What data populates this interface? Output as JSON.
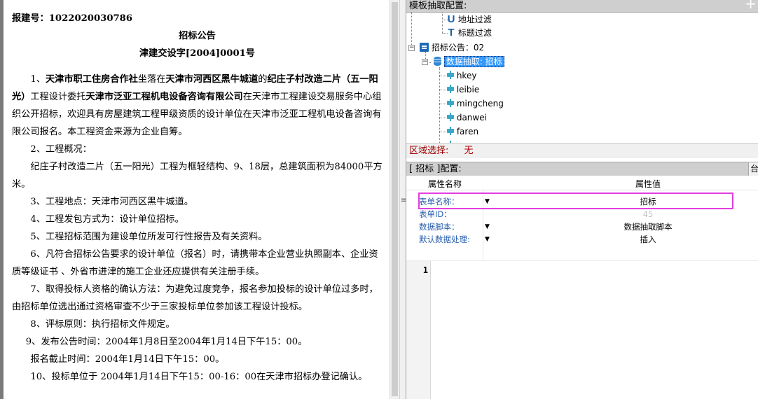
{
  "document": {
    "report_no": "报建号：1022020030786",
    "title": "招标公告",
    "code": "津建交设字[2004]0001号",
    "p1_prefix": "1、",
    "p1_b1": "天津市职工住房合作社",
    "p1_t1": "坐落在",
    "p1_b2": "天津市河西区黑牛城道",
    "p1_t2": "的",
    "p1_b3": "纪庄子村改造二片（五一阳光）",
    "p1_t3": "工程设计委托",
    "p1_b4": "天津市泛亚工程机电设备咨询有限公司",
    "p1_t4": "在天津市工程建设交易服务中心组织公开招标，欢迎具有房屋建筑工程甲级资质的设计单位在天津市泛亚工程机电设备咨询有限公司报名。本工程资金来源为企业自筹。",
    "p2": "2、工程概况：",
    "p2_body": "纪庄子村改造二片（五一阳光）工程为框轻结构、9、18层，总建筑面积为84000平方米。",
    "p3": "3、工程地点：天津市河西区黑牛城道。",
    "p4": "4、工程发包方式为：设计单位招标。",
    "p5": "5、工程招标范围为建设单位所发可行性报告及有关资料。",
    "p6": "6、凡符合招标公告要求的设计单位（报名）时，请携带本企业营业执照副本、企业资质等级证书 、外省市进津的施工企业还应提供有关注册手续。",
    "p7": "7、取得投标人资格的确认方法：为避免过度竞争，报名参加投标的设计单位过多时，由招标单位选出通过资格审查不少于三家投标单位参加该工程设计投标。",
    "p8": "8、评标原则：执行招标文件规定。",
    "p9": "9、发布公告时间：2004年1月8日至2004年1月14日下午15：00。",
    "p9b": "报名截止时间：2004年1月14日下午15：00。",
    "p10": "10、投标单位于 2004年1月14日下午15：00-16：00在天津市招标办登记确认。"
  },
  "template_panel": {
    "header": "模板抽取配置:",
    "add_icon": "+",
    "tree": {
      "url_filter": "地址过滤",
      "title_filter": "标题过滤",
      "notice_node": "招标公告：02",
      "extract_node": "数据抽取: 招标",
      "fields": [
        "hkey",
        "leibie",
        "mingcheng",
        "danwei",
        "faren"
      ]
    },
    "region_label": "区域选择:",
    "region_value": "无"
  },
  "config_panel": {
    "header": "[ 招标 ]配置:",
    "tab_label": "台",
    "col_name": "属性名称",
    "col_value": "属性值",
    "rows": [
      {
        "name": "表单名称：",
        "value": "招标"
      },
      {
        "name": "表单ID：",
        "value": "45"
      },
      {
        "name": "数据脚本：",
        "value": "数据抽取脚本"
      },
      {
        "name": "默认数据处理:",
        "value": "插入"
      }
    ]
  },
  "editor": {
    "line_number": "1"
  },
  "icons": {
    "url_filter": "U",
    "title_filter": "T",
    "dropdown": "▼",
    "splitter": "≡"
  }
}
